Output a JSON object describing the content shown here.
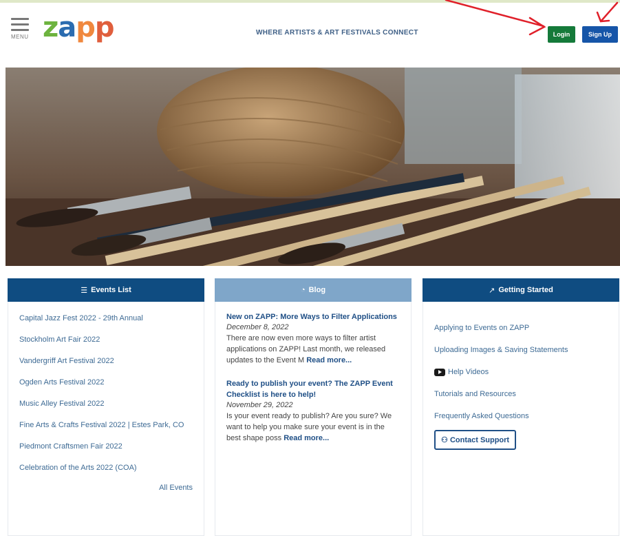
{
  "header": {
    "menu_label": "MENU",
    "logo": "zapp",
    "tagline": "WHERE ARTISTS & ART FESTIVALS CONNECT",
    "login_label": "Login",
    "signup_label": "Sign Up",
    "accent_arrow_color": "#e0202a"
  },
  "events": {
    "title": "Events List",
    "icon": "list-icon",
    "items": [
      "Capital Jazz Fest 2022 - 29th Annual",
      "Stockholm Art Fair 2022",
      "Vandergriff Art Festival 2022",
      "Ogden Arts Festival 2022",
      "Music Alley Festival 2022",
      "Fine Arts & Crafts Festival 2022 | Estes Park, CO",
      "Piedmont Craftsmen Fair 2022",
      "Celebration of the Arts 2022 (COA)"
    ],
    "all_events": "All Events"
  },
  "blog": {
    "title": "Blog",
    "icon": "rss-icon",
    "posts": [
      {
        "title": "New on ZAPP: More Ways to Filter Applications",
        "date": "December 8, 2022",
        "text": "There are now even more ways to filter artist applications on ZAPP! Last month, we released updates to the Event M",
        "more": "Read more..."
      },
      {
        "title": "Ready to publish your event? The ZAPP Event Checklist is here to help!",
        "date": "November 29, 2022",
        "text": "Is your event ready to publish? Are you sure?  We want to help you make sure your event is in the best shape poss",
        "more": "Read more..."
      }
    ]
  },
  "getting_started": {
    "title": "Getting Started",
    "icon": "external-link-icon",
    "links": [
      "Applying to Events on ZAPP",
      "Uploading Images & Saving Statements",
      "Help Videos",
      "Tutorials and Resources",
      "Frequently Asked Questions"
    ],
    "contact_label": "Contact Support",
    "contact_icon": "support-person-icon"
  },
  "colors": {
    "header_dark_blue": "#0f4c81",
    "header_light_blue": "#7fa6c9",
    "login_green": "#157a3a",
    "signup_blue": "#1655a8"
  }
}
